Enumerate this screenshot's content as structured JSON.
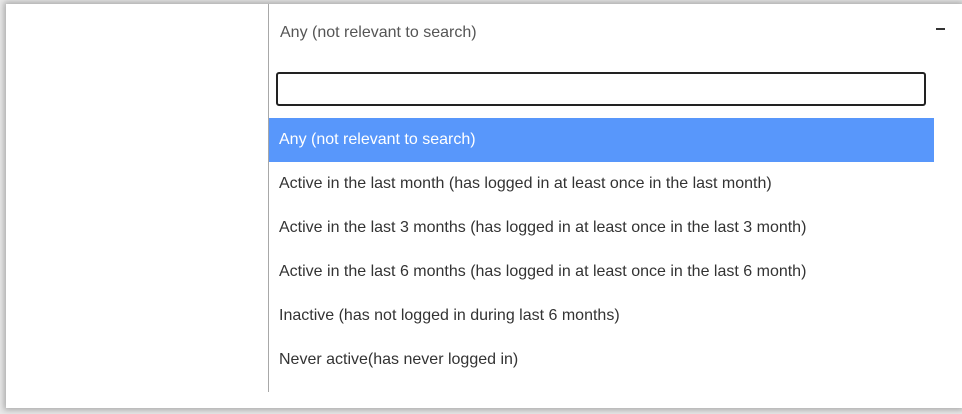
{
  "select": {
    "current_value": "Any (not relevant to search)",
    "search_value": "",
    "options": [
      {
        "label": "Any (not relevant to search)",
        "selected": true
      },
      {
        "label": "Active in the last month (has logged in at least once in the last month)",
        "selected": false
      },
      {
        "label": "Active in the last 3 months (has logged in at least once in the last 3 month)",
        "selected": false
      },
      {
        "label": "Active in the last 6 months (has logged in at least once in the last 6 month)",
        "selected": false
      },
      {
        "label": "Inactive (has not logged in during last 6 months)",
        "selected": false
      },
      {
        "label": "Never active(has never logged in)",
        "selected": false
      }
    ]
  },
  "colors": {
    "highlight": "#5897fb",
    "highlight_text": "#ffffff",
    "option_text": "#333333"
  },
  "icons": {
    "toggle": "chevron-up-icon"
  }
}
